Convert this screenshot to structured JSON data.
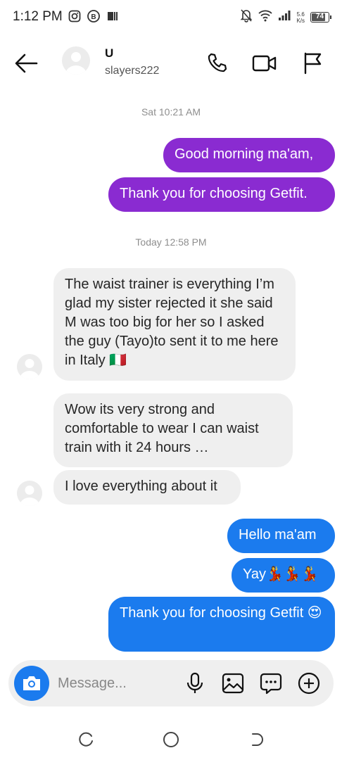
{
  "status_bar": {
    "time": "1:12 PM",
    "net_speed_value": "5.6",
    "net_speed_unit": "K/s",
    "battery": "74",
    "icons_left": [
      "instagram-icon",
      "business-icon",
      "gallery-icon"
    ],
    "icons_right": [
      "mute-icon",
      "wifi-icon",
      "signal-icon",
      "battery-icon"
    ]
  },
  "header": {
    "name": "U",
    "username": "slayers222",
    "actions": [
      "phone-icon",
      "video-icon",
      "flag-icon"
    ]
  },
  "messages": [
    {
      "type": "timestamp",
      "text": "Sat 10:21 AM"
    },
    {
      "type": "outgoing",
      "text": "Good morning ma'am,"
    },
    {
      "type": "outgoing",
      "text": "Thank you for choosing Getfit."
    },
    {
      "type": "timestamp",
      "text": "Today 12:58 PM"
    },
    {
      "type": "incoming",
      "text": "The waist trainer is everything I’m glad my sister rejected it she said M was too big for her so I asked the guy (Tayo)to sent it to me here in Italy 🇮🇹"
    },
    {
      "type": "incoming",
      "text": "Wow its very strong and comfortable to wear I can waist train with it 24 hours …"
    },
    {
      "type": "incoming",
      "text": "I love everything about it"
    },
    {
      "type": "outgoing",
      "text": "Hello ma'am"
    },
    {
      "type": "outgoing",
      "text": "Yay💃💃💃"
    },
    {
      "type": "outgoing",
      "text": "Thank you for choosing Getfit 😍"
    }
  ],
  "composer": {
    "placeholder": "Message...",
    "icons": [
      "camera-icon",
      "microphone-icon",
      "image-icon",
      "sticker-icon",
      "plus-icon"
    ]
  },
  "colors": {
    "purple_bubble": "#8a2bd1",
    "blue_bubble": "#1b7bee",
    "incoming_bubble": "#efefef",
    "timestamp": "#8e8e8e"
  }
}
